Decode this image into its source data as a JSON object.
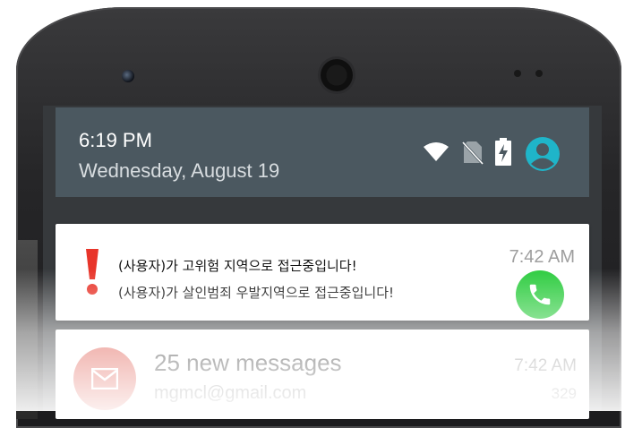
{
  "status_bar": {
    "time": "6:19 PM",
    "date": "Wednesday, August 19",
    "icons": [
      "wifi-icon",
      "no-sim-icon",
      "battery-charging-icon",
      "account-icon"
    ]
  },
  "notifications": [
    {
      "icon": "exclamation-alert-icon",
      "lines": [
        "(사용자)가 고위험 지역으로 접근중입니다!",
        "(사용자)가 살인범죄 우발지역으로 접근중입니다!"
      ],
      "time": "7:42 AM",
      "action_icon": "phone-call-icon"
    },
    {
      "icon": "gmail-icon",
      "title": "25 new messages",
      "subtitle": "mgmcl@gmail.com",
      "time": "7:42 AM",
      "count": "329"
    }
  ],
  "colors": {
    "status_panel": "#4b5860",
    "alert_red": "#e8352a",
    "call_green": "#2ecc40",
    "account_teal": "#1fb5c9",
    "gmail_red": "#db4437"
  }
}
